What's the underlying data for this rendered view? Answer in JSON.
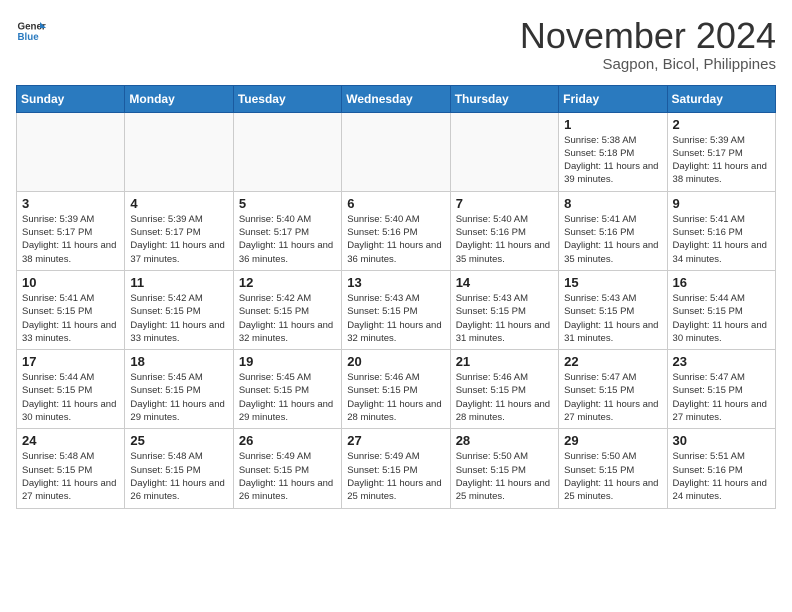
{
  "header": {
    "logo_line1": "General",
    "logo_line2": "Blue",
    "month": "November 2024",
    "location": "Sagpon, Bicol, Philippines"
  },
  "weekdays": [
    "Sunday",
    "Monday",
    "Tuesday",
    "Wednesday",
    "Thursday",
    "Friday",
    "Saturday"
  ],
  "weeks": [
    [
      {
        "day": "",
        "info": ""
      },
      {
        "day": "",
        "info": ""
      },
      {
        "day": "",
        "info": ""
      },
      {
        "day": "",
        "info": ""
      },
      {
        "day": "",
        "info": ""
      },
      {
        "day": "1",
        "info": "Sunrise: 5:38 AM\nSunset: 5:18 PM\nDaylight: 11 hours and 39 minutes."
      },
      {
        "day": "2",
        "info": "Sunrise: 5:39 AM\nSunset: 5:17 PM\nDaylight: 11 hours and 38 minutes."
      }
    ],
    [
      {
        "day": "3",
        "info": "Sunrise: 5:39 AM\nSunset: 5:17 PM\nDaylight: 11 hours and 38 minutes."
      },
      {
        "day": "4",
        "info": "Sunrise: 5:39 AM\nSunset: 5:17 PM\nDaylight: 11 hours and 37 minutes."
      },
      {
        "day": "5",
        "info": "Sunrise: 5:40 AM\nSunset: 5:17 PM\nDaylight: 11 hours and 36 minutes."
      },
      {
        "day": "6",
        "info": "Sunrise: 5:40 AM\nSunset: 5:16 PM\nDaylight: 11 hours and 36 minutes."
      },
      {
        "day": "7",
        "info": "Sunrise: 5:40 AM\nSunset: 5:16 PM\nDaylight: 11 hours and 35 minutes."
      },
      {
        "day": "8",
        "info": "Sunrise: 5:41 AM\nSunset: 5:16 PM\nDaylight: 11 hours and 35 minutes."
      },
      {
        "day": "9",
        "info": "Sunrise: 5:41 AM\nSunset: 5:16 PM\nDaylight: 11 hours and 34 minutes."
      }
    ],
    [
      {
        "day": "10",
        "info": "Sunrise: 5:41 AM\nSunset: 5:15 PM\nDaylight: 11 hours and 33 minutes."
      },
      {
        "day": "11",
        "info": "Sunrise: 5:42 AM\nSunset: 5:15 PM\nDaylight: 11 hours and 33 minutes."
      },
      {
        "day": "12",
        "info": "Sunrise: 5:42 AM\nSunset: 5:15 PM\nDaylight: 11 hours and 32 minutes."
      },
      {
        "day": "13",
        "info": "Sunrise: 5:43 AM\nSunset: 5:15 PM\nDaylight: 11 hours and 32 minutes."
      },
      {
        "day": "14",
        "info": "Sunrise: 5:43 AM\nSunset: 5:15 PM\nDaylight: 11 hours and 31 minutes."
      },
      {
        "day": "15",
        "info": "Sunrise: 5:43 AM\nSunset: 5:15 PM\nDaylight: 11 hours and 31 minutes."
      },
      {
        "day": "16",
        "info": "Sunrise: 5:44 AM\nSunset: 5:15 PM\nDaylight: 11 hours and 30 minutes."
      }
    ],
    [
      {
        "day": "17",
        "info": "Sunrise: 5:44 AM\nSunset: 5:15 PM\nDaylight: 11 hours and 30 minutes."
      },
      {
        "day": "18",
        "info": "Sunrise: 5:45 AM\nSunset: 5:15 PM\nDaylight: 11 hours and 29 minutes."
      },
      {
        "day": "19",
        "info": "Sunrise: 5:45 AM\nSunset: 5:15 PM\nDaylight: 11 hours and 29 minutes."
      },
      {
        "day": "20",
        "info": "Sunrise: 5:46 AM\nSunset: 5:15 PM\nDaylight: 11 hours and 28 minutes."
      },
      {
        "day": "21",
        "info": "Sunrise: 5:46 AM\nSunset: 5:15 PM\nDaylight: 11 hours and 28 minutes."
      },
      {
        "day": "22",
        "info": "Sunrise: 5:47 AM\nSunset: 5:15 PM\nDaylight: 11 hours and 27 minutes."
      },
      {
        "day": "23",
        "info": "Sunrise: 5:47 AM\nSunset: 5:15 PM\nDaylight: 11 hours and 27 minutes."
      }
    ],
    [
      {
        "day": "24",
        "info": "Sunrise: 5:48 AM\nSunset: 5:15 PM\nDaylight: 11 hours and 27 minutes."
      },
      {
        "day": "25",
        "info": "Sunrise: 5:48 AM\nSunset: 5:15 PM\nDaylight: 11 hours and 26 minutes."
      },
      {
        "day": "26",
        "info": "Sunrise: 5:49 AM\nSunset: 5:15 PM\nDaylight: 11 hours and 26 minutes."
      },
      {
        "day": "27",
        "info": "Sunrise: 5:49 AM\nSunset: 5:15 PM\nDaylight: 11 hours and 25 minutes."
      },
      {
        "day": "28",
        "info": "Sunrise: 5:50 AM\nSunset: 5:15 PM\nDaylight: 11 hours and 25 minutes."
      },
      {
        "day": "29",
        "info": "Sunrise: 5:50 AM\nSunset: 5:15 PM\nDaylight: 11 hours and 25 minutes."
      },
      {
        "day": "30",
        "info": "Sunrise: 5:51 AM\nSunset: 5:16 PM\nDaylight: 11 hours and 24 minutes."
      }
    ]
  ]
}
